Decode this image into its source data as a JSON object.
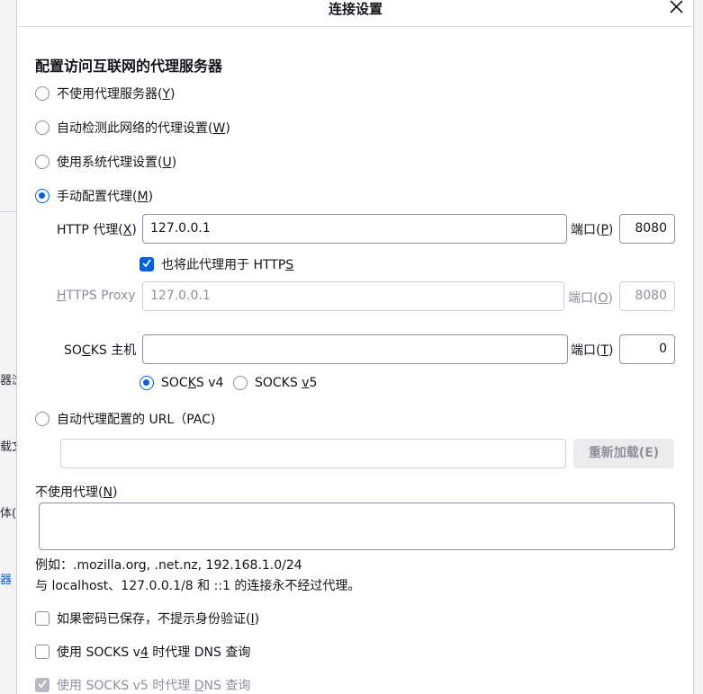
{
  "dialog": {
    "title": "连接设置"
  },
  "section_title": "配置访问互联网的代理服务器",
  "radios": {
    "no_proxy": {
      "label": "不使用代理服务器",
      "key": "Y"
    },
    "auto_detect": {
      "label": "自动检测此网络的代理设置",
      "key": "W"
    },
    "system": {
      "label": "使用系统代理设置",
      "key": "U"
    },
    "manual": {
      "label": "手动配置代理",
      "key": "M"
    },
    "pac": {
      "label": "自动代理配置的 URL（PAC)"
    }
  },
  "selected_mode": "manual",
  "http": {
    "label_prefix": "HTTP 代理(",
    "key": "X",
    "label_suffix": ")",
    "value": "127.0.0.1",
    "port_prefix": "端口(",
    "port_key": "P",
    "port_suffix": ")",
    "port": "8080"
  },
  "also_https": {
    "label_prefix": "也将此代理用于 HTTP",
    "key": "S",
    "checked": true
  },
  "https": {
    "label_key": "H",
    "label_rest": "TTPS Proxy",
    "value": "127.0.0.1",
    "port_prefix": "端口(",
    "port_key": "O",
    "port_suffix": ")",
    "port": "8080"
  },
  "socks": {
    "label_a": "SO",
    "key": "C",
    "label_b": "KS 主机",
    "value": "",
    "port_prefix": "端口(",
    "port_key": "T",
    "port_suffix": ")",
    "port": "0"
  },
  "socks_version": {
    "v4_a": "SOC",
    "v4_key": "K",
    "v4_b": "S v4",
    "v5_a": "SOCKS ",
    "v5_key": "v",
    "v5_b": "5",
    "selected": "v4"
  },
  "pac": {
    "url_value": "",
    "reload_label": "重新加载(E)"
  },
  "no_proxy_for": {
    "label_prefix": "不使用代理(",
    "key": "N",
    "label_suffix": ")",
    "value": ""
  },
  "hints": {
    "example": "例如：.mozilla.org, .net.nz, 192.168.1.0/24",
    "localhost": "与 localhost、127.0.0.1/8 和 ::1 的连接永不经过代理。"
  },
  "checkboxes": {
    "no_auth_prompt": {
      "label_prefix": "如果密码已保存，不提示身份验证(",
      "key": "I",
      "label_suffix": ")",
      "checked": false
    },
    "socks_v4_dns": {
      "label_a": "使用 SOCKS v",
      "key": "4",
      "label_b": " 时代理 DNS 查询",
      "checked": false
    },
    "socks_v5_dns": {
      "label_a": "使用 SOCKS v5 时代理 ",
      "key": "D",
      "label_b": "NS 查询",
      "checked": true,
      "disabled": true
    }
  },
  "background_fragments": [
    "器浏",
    "载文",
    "体(V",
    "器"
  ],
  "colors": {
    "accent": "#0061e0",
    "border": "#8f8f9d",
    "disabled_text": "#8f8f9d"
  }
}
